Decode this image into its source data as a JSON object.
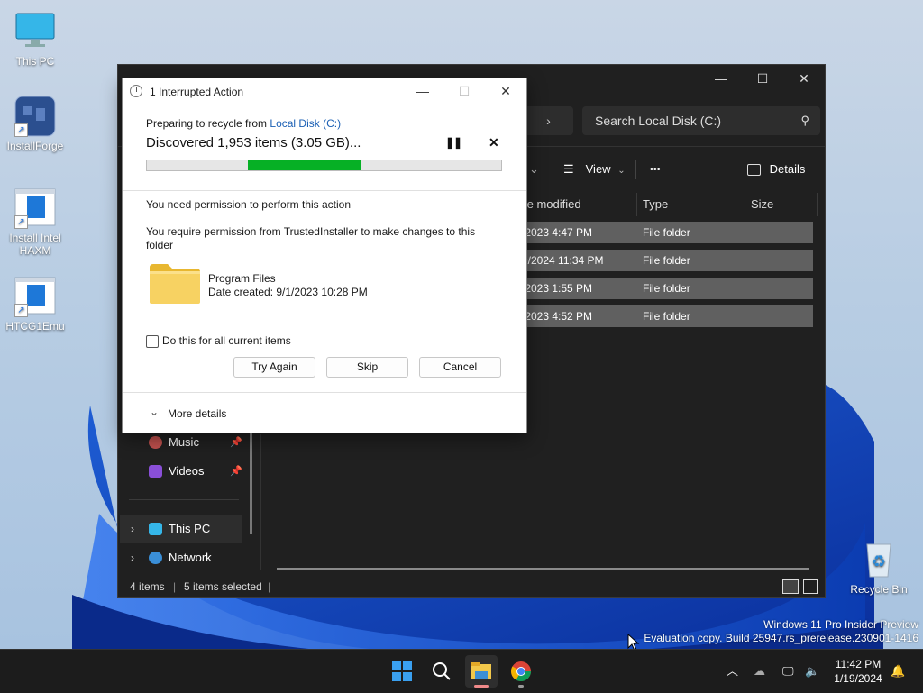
{
  "desktop": {
    "icons": [
      {
        "label": "This PC"
      },
      {
        "label": "InstallForge"
      },
      {
        "label": "Install Intel HAXM"
      },
      {
        "label": "HTCG1Emu"
      },
      {
        "label": "Recycle Bin"
      }
    ],
    "watermark_line1": "Windows 11 Pro Insider Preview",
    "watermark_line2": "Evaluation copy. Build 25947.rs_prerelease.230901-1416"
  },
  "explorer": {
    "search_placeholder": "Search Local Disk (C:)",
    "breadcrumb_arrow": "›",
    "toolbar": {
      "view_label": "View",
      "details_label": "Details",
      "more_label": "•••"
    },
    "columns": {
      "date": "te modified",
      "type": "Type",
      "size": "Size"
    },
    "rows": [
      {
        "date": "/2023 4:47 PM",
        "type": "File folder"
      },
      {
        "date": "9/2024 11:34 PM",
        "type": "File folder"
      },
      {
        "date": "/2023 1:55 PM",
        "type": "File folder"
      },
      {
        "date": "/2023 4:52 PM",
        "type": "File folder"
      }
    ],
    "nav": {
      "music": "Music",
      "videos": "Videos",
      "this_pc": "This PC",
      "network": "Network"
    },
    "status": {
      "items": "4 items",
      "selected": "5 items selected"
    }
  },
  "dialog": {
    "title": "1 Interrupted Action",
    "preparing_prefix": "Preparing to recycle from ",
    "preparing_link": "Local Disk (C:)",
    "discovered": "Discovered 1,953 items (3.05 GB)...",
    "progress": {
      "start": 0.285,
      "end": 0.605
    },
    "permission_heading": "You need permission to perform this action",
    "permission_detail": "You require permission from TrustedInstaller to make changes to this folder",
    "item_name": "Program Files",
    "item_date": "Date created: 9/1/2023 10:28 PM",
    "checkbox_label": "Do this for all current items",
    "buttons": {
      "try_again": "Try Again",
      "skip": "Skip",
      "cancel": "Cancel"
    },
    "more_details": "More details"
  },
  "taskbar": {
    "time": "11:42 PM",
    "date": "1/19/2024"
  },
  "colors": {
    "progress_fill": "#06b025",
    "link": "#1a5fb4",
    "explorer_bg": "#202020",
    "taskbar_bg": "#1c1c1c"
  }
}
